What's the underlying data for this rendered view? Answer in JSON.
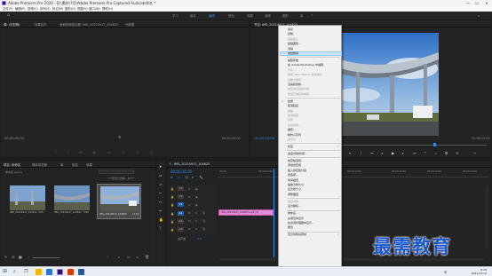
{
  "window": {
    "title": "Adobe Premiere Pro 2020 - D:\\素材\\7月\\Adobe Premiere Pro Captured Audio\\未命名 *",
    "controls": [
      "—",
      "☐",
      "✕"
    ]
  },
  "menubar": [
    "文件(F)",
    "编辑(E)",
    "剪辑(C)",
    "序列(S)",
    "标记(M)",
    "图形(G)",
    "视图(V)",
    "窗口(W)",
    "帮助(H)"
  ],
  "workspaces": {
    "items": [
      "学习",
      "组件",
      "编辑",
      "颜色",
      "效果",
      "音频",
      "图形",
      "库"
    ],
    "active": "编辑"
  },
  "source_panel": {
    "tabs": [
      "源: (无剪辑)",
      "效果控件",
      "音频剪辑混合器: IMG_20210917_104825",
      "元数据"
    ],
    "timecode_left": "00;00;00;00",
    "timecode_right": "00;00;00;00"
  },
  "program_panel": {
    "tab": "节目: IMG_20210917_104825",
    "timecode_left": "00;00;10;00",
    "fit": "适合",
    "quality": "完整",
    "timecode_right": "00;00;13;02"
  },
  "project_panel": {
    "tabs": [
      "项目: 未命名",
      "媒体浏览器",
      "库",
      "信息",
      "效果"
    ],
    "path": "未命名.prproj",
    "count": "1个项目已选择，共4个",
    "clips": [
      {
        "name": "IMG_20210917_104311",
        "duration": "5:05"
      },
      {
        "name": "IMG_20210917_104824",
        "duration": "5:00"
      },
      {
        "name": "IMG_20210917_104825",
        "duration": "13:02"
      }
    ]
  },
  "timeline": {
    "tab": "IMG_20210917_104825",
    "timecode": "00;00;10;00",
    "ruler": [
      "00;00",
      "00;00;04;00",
      "00;00;08;00",
      "00;00;12;00",
      "00;00;16;00",
      "00;00;20;00",
      "00;00;24;00"
    ],
    "video_tracks": [
      "V3",
      "V2",
      "V1"
    ],
    "audio_tracks": [
      "A1",
      "A2",
      "A3"
    ],
    "master": "主声道",
    "master_value": "0.0",
    "clip_label": "IMG_20210917_104825.mp4 [V]"
  },
  "context_menu": {
    "items": [
      {
        "label": "剪切",
        "enabled": true
      },
      {
        "label": "复制",
        "enabled": true
      },
      {
        "label": "粘贴插入",
        "enabled": false
      },
      {
        "label": "粘贴属性...",
        "enabled": true
      },
      {
        "label": "清除",
        "enabled": true
      },
      {
        "label": "波纹删除",
        "enabled": true,
        "highlight": true
      },
      {
        "sep": true
      },
      {
        "label": "编辑原始",
        "enabled": true
      },
      {
        "label": "在 Adobe Photoshop 中编辑",
        "enabled": true
      },
      {
        "label": "许可...",
        "enabled": false
      },
      {
        "label": "使用 After Effects 合成替换",
        "enabled": false
      },
      {
        "label": "替换为剪辑",
        "enabled": false
      },
      {
        "label": "渲染和替换...",
        "enabled": true
      },
      {
        "label": "恢复未渲染的内容",
        "enabled": false
      },
      {
        "label": "恢复已捕获的剪辑",
        "enabled": false
      },
      {
        "sep": true
      },
      {
        "label": "启用",
        "enabled": true,
        "checked": true
      },
      {
        "label": "取消链接",
        "enabled": true
      },
      {
        "label": "编组",
        "enabled": false
      },
      {
        "label": "取消编组",
        "enabled": false
      },
      {
        "label": "同步",
        "enabled": false
      },
      {
        "label": "合并剪辑...",
        "enabled": false
      },
      {
        "label": "嵌套...",
        "enabled": true
      },
      {
        "label": "制作子序列",
        "enabled": true
      },
      {
        "label": "多机位",
        "enabled": false,
        "submenu": true
      },
      {
        "sep": true
      },
      {
        "label": "标签",
        "enabled": true,
        "submenu": true
      },
      {
        "sep": true
      },
      {
        "label": "速度/持续时间...",
        "enabled": true
      },
      {
        "sep": true
      },
      {
        "label": "帧定格选项...",
        "enabled": true
      },
      {
        "label": "添加帧定格",
        "enabled": true
      },
      {
        "label": "插入帧定格分段",
        "enabled": true
      },
      {
        "label": "场选项...",
        "enabled": true
      },
      {
        "label": "时间插值",
        "enabled": true,
        "submenu": true
      },
      {
        "label": "缩放为帧大小",
        "enabled": true
      },
      {
        "label": "设为帧大小",
        "enabled": true
      },
      {
        "label": "调整图层",
        "enabled": true
      },
      {
        "sep": true
      },
      {
        "label": "链接媒体...",
        "enabled": false
      },
      {
        "label": "设为脱机...",
        "enabled": true
      },
      {
        "sep": true
      },
      {
        "label": "重命名...",
        "enabled": true
      },
      {
        "label": "在项目中显示",
        "enabled": true
      },
      {
        "label": "在资源管理器中显示...",
        "enabled": true
      },
      {
        "label": "属性",
        "enabled": true
      },
      {
        "sep": true
      },
      {
        "label": "显示剪辑关键帧",
        "enabled": true,
        "submenu": true
      }
    ]
  },
  "taskbar": {
    "time": "8:29",
    "date": "2021/11/12",
    "ime": "中"
  },
  "watermark": "最需教育",
  "colors": {
    "accent": "#2d8ceb",
    "clip_pink": "#e58ad6",
    "menu_highlight": "#cce4f7"
  }
}
